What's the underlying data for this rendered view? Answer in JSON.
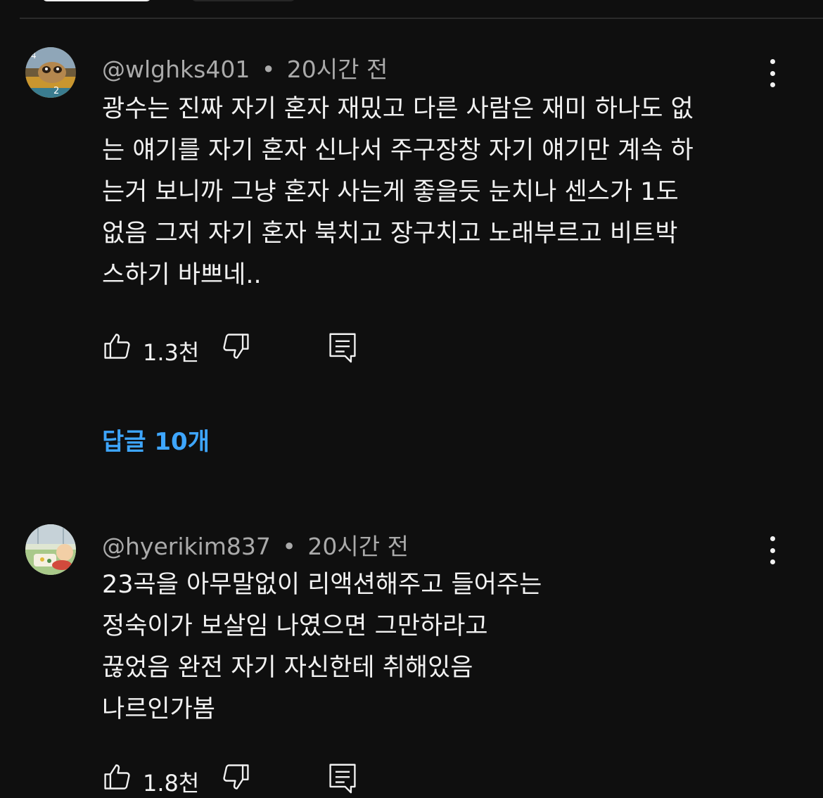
{
  "comments": [
    {
      "handle": "@wlghks401",
      "time": "20시간 전",
      "lines": [
        "광수는 진짜 자기 혼자 재밌고 다른 사람은 재미 하나도 없",
        "는 얘기를 자기 혼자 신나서 주구장창 자기 얘기만 계속 하",
        "는거 보니까 그냥 혼자 사는게 좋을듯 눈치나 센스가 1도",
        "없음 그저 자기 혼자 북치고 장구치고 노래부르고 비트박",
        "스하기 바쁘네.."
      ],
      "likes": "1.3천",
      "replies_label": "답글 10개"
    },
    {
      "handle": "@hyerikim837",
      "time": "20시간 전",
      "lines": [
        "23곡을 아무말없이 리액션해주고 들어주는",
        "정숙이가 보살임  나였으면 그만하라고",
        "끊었음 완전 자기 자신한테 취해있음",
        "나르인가봄"
      ],
      "likes": "1.8천"
    }
  ],
  "separator": "•",
  "colors": {
    "background": "#0f0f0f",
    "text": "#f1f1f1",
    "meta": "#aaaaaa",
    "link": "#3ea6ff"
  },
  "icons": [
    "avatar",
    "more-vert-icon",
    "thumbs-up-icon",
    "thumbs-down-icon",
    "reply-icon"
  ]
}
